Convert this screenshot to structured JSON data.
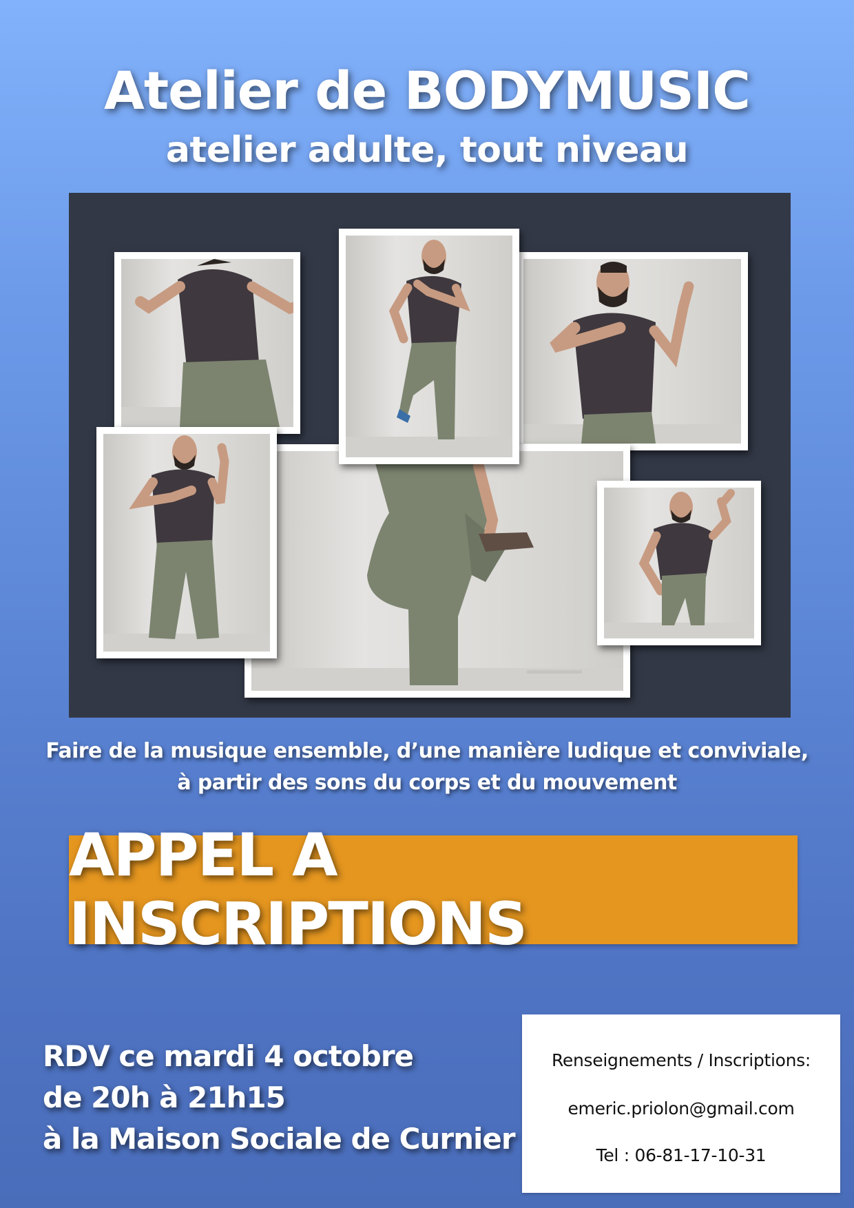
{
  "header": {
    "title": "Atelier de BODYMUSIC",
    "subtitle": "atelier adulte, tout niveau"
  },
  "collage": {
    "photos": [
      {
        "icon": "dancer-snapping-photo"
      },
      {
        "icon": "dancer-leg-raised-photo"
      },
      {
        "icon": "dancer-hand-on-chest-photo"
      },
      {
        "icon": "dancer-standing-photo"
      },
      {
        "icon": "dancer-leg-closeup-photo"
      },
      {
        "icon": "dancer-crouching-photo"
      }
    ]
  },
  "description": {
    "line1": "Faire de la musique ensemble, d’une manière ludique et conviviale,",
    "line2": "à partir des sons du corps et du mouvement"
  },
  "banner": {
    "label": "APPEL A INSCRIPTIONS"
  },
  "rendezvous": {
    "line1": "RDV ce mardi 4 octobre",
    "line2": "de 20h à 21h15",
    "line3": "à la Maison Sociale de Curnier"
  },
  "contact": {
    "heading": "Renseignements / Inscriptions:",
    "email": "emeric.priolon@gmail.com",
    "phone": "Tel : 06-81-17-10-31"
  },
  "colors": {
    "background_top": "#82b2fb",
    "background_bottom": "#4a6dba",
    "collage_background": "#323846",
    "banner": "#e5961f",
    "shirt": "#3f383e",
    "trousers": "#7c8470"
  }
}
